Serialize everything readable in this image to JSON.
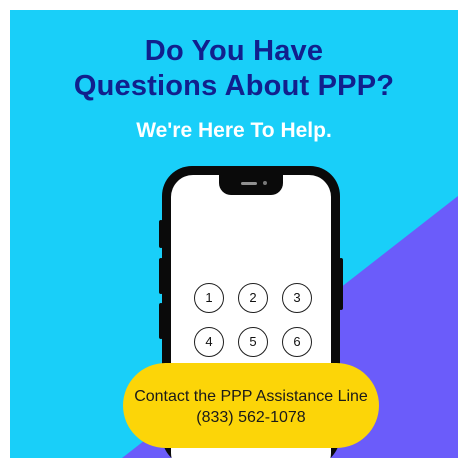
{
  "headline": {
    "line1": "Do You Have",
    "line2": "Questions About PPP?"
  },
  "subheadline": "We're Here To Help.",
  "phone": {
    "keypad": [
      "1",
      "2",
      "3",
      "4",
      "5",
      "6"
    ]
  },
  "cta": {
    "line1": "Contact the PPP Assistance Line",
    "phone_number": "(833) 562-1078"
  },
  "colors": {
    "background": "#19cff9",
    "accent_triangle": "#6b5cfa",
    "headline": "#11208d",
    "subheadline": "#ffffff",
    "phone_body": "#0a0a0a",
    "cta_background": "#fcd508"
  }
}
